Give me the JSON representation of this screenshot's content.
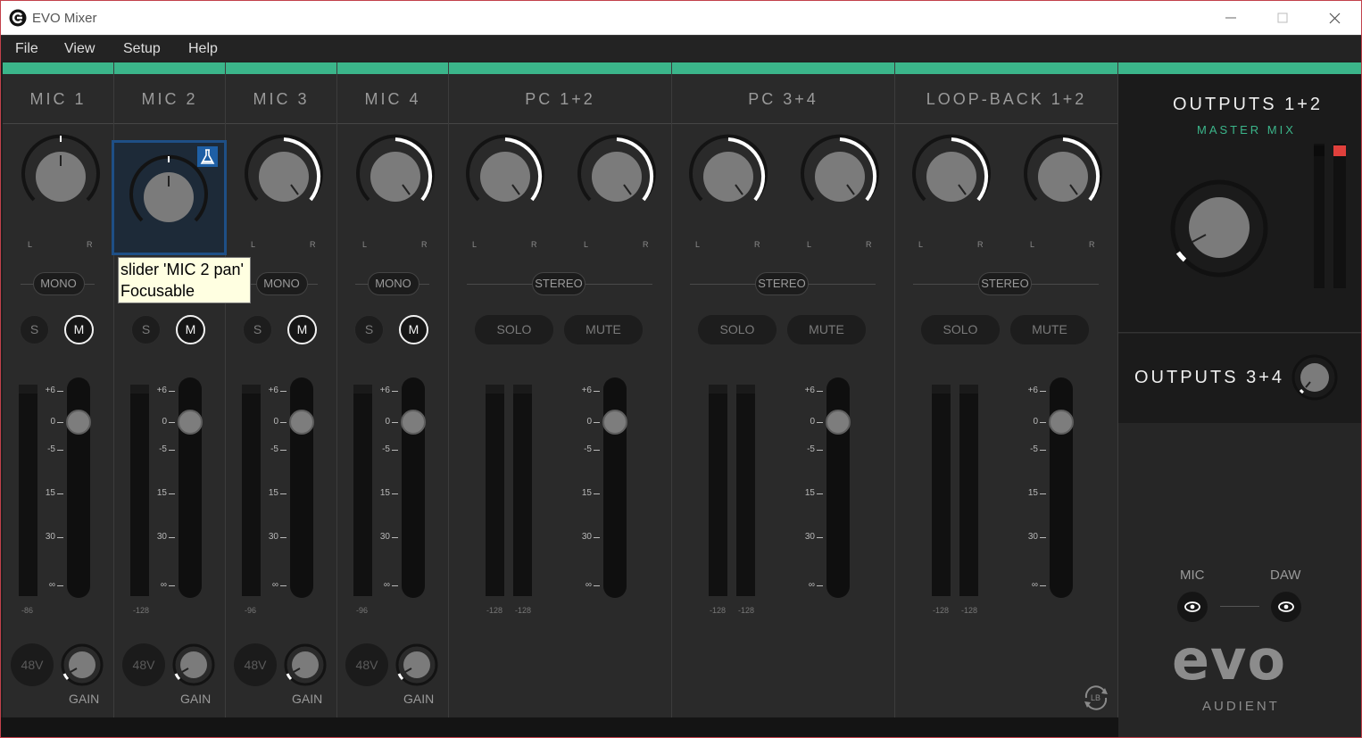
{
  "window": {
    "title": "EVO Mixer",
    "minimize_icon": "minimize-icon",
    "maximize_icon": "maximize-icon",
    "close_icon": "close-icon"
  },
  "menu": [
    "File",
    "View",
    "Setup",
    "Help"
  ],
  "channels": [
    {
      "name": "MIC 1",
      "mode": "MONO",
      "solo": "S",
      "mute": "M",
      "meter_floor": "-86",
      "phantom": "48V",
      "gain": "GAIN"
    },
    {
      "name": "MIC 2",
      "mode": "MONO",
      "solo": "S",
      "mute": "M",
      "meter_floor": "-128",
      "phantom": "48V",
      "gain": "GAIN"
    },
    {
      "name": "MIC 3",
      "mode": "MONO",
      "solo": "S",
      "mute": "M",
      "meter_floor": "-96",
      "phantom": "48V",
      "gain": "GAIN"
    },
    {
      "name": "MIC 4",
      "mode": "MONO",
      "solo": "S",
      "mute": "M",
      "meter_floor": "-96",
      "phantom": "48V",
      "gain": "GAIN"
    },
    {
      "name": "PC 1+2",
      "mode": "STEREO",
      "solo": "SOLO",
      "mute": "MUTE",
      "meter_floor_l": "-128",
      "meter_floor_r": "-128"
    },
    {
      "name": "PC 3+4",
      "mode": "STEREO",
      "solo": "SOLO",
      "mute": "MUTE",
      "meter_floor_l": "-128",
      "meter_floor_r": "-128"
    },
    {
      "name": "LOOP-BACK 1+2",
      "mode": "STEREO",
      "solo": "SOLO",
      "mute": "MUTE",
      "meter_floor_l": "-128",
      "meter_floor_r": "-128"
    }
  ],
  "pan_labels": {
    "left": "L",
    "right": "R"
  },
  "fader_scale": [
    "+6",
    "0",
    "-5",
    "15",
    "30",
    "∞"
  ],
  "master": {
    "outputs_1_2": "OUTPUTS 1+2",
    "master_mix": "MASTER MIX",
    "outputs_3_4": "OUTPUTS 3+4",
    "mic_label": "MIC",
    "daw_label": "DAW",
    "brand": "evo",
    "brand_sub": "AUDIENT",
    "clip_color": "#e0403c"
  },
  "loopback_icon": {
    "label": "LB",
    "icon": "loopback-sync-icon"
  },
  "tooltip": {
    "line1": "slider 'MIC 2 pan'",
    "line2": "Focusable"
  },
  "colors": {
    "accent": "#3bb58a",
    "focus": "#1e4f86"
  }
}
